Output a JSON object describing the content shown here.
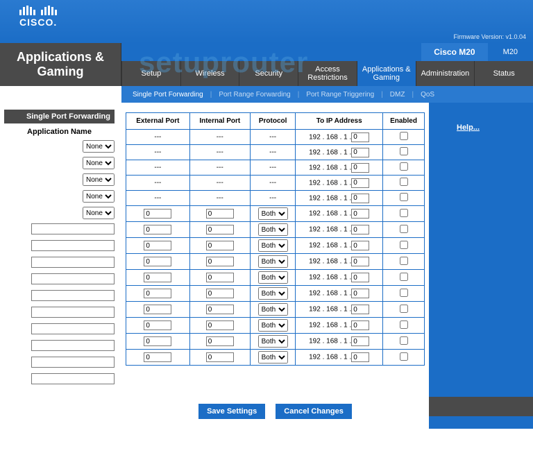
{
  "brand": "CISCO.",
  "firmware": "Firmware Version: v1.0.04",
  "model_name": "Cisco M20",
  "model_code": "M20",
  "page_title": "Applications & Gaming",
  "watermark": "setuprouter",
  "tabs": [
    {
      "label": "Setup"
    },
    {
      "label": "Wireless"
    },
    {
      "label": "Security"
    },
    {
      "label": "Access Restrictions"
    },
    {
      "label": "Applications & Gaming",
      "active": true
    },
    {
      "label": "Administration"
    },
    {
      "label": "Status"
    }
  ],
  "subtabs": [
    {
      "label": "Single Port Forwarding",
      "active": true
    },
    {
      "label": "Port Range Forwarding"
    },
    {
      "label": "Port Range Triggering"
    },
    {
      "label": "DMZ"
    },
    {
      "label": "QoS"
    }
  ],
  "sidebar": {
    "section": "Single Port Forwarding",
    "field_label": "Application Name",
    "preset_option": "None",
    "preset_count": 5,
    "text_count": 10
  },
  "grid": {
    "headers": {
      "external": "External Port",
      "internal": "Internal Port",
      "protocol": "Protocol",
      "ip": "To IP Address",
      "enabled": "Enabled"
    },
    "dash": "---",
    "protocol_option": "Both",
    "ip_prefix": "192 . 168 . 1 .",
    "default_port": "0",
    "default_oct": "0",
    "preset_rows": 5,
    "custom_rows": 10
  },
  "help": "Help...",
  "buttons": {
    "save": "Save Settings",
    "cancel": "Cancel Changes"
  }
}
